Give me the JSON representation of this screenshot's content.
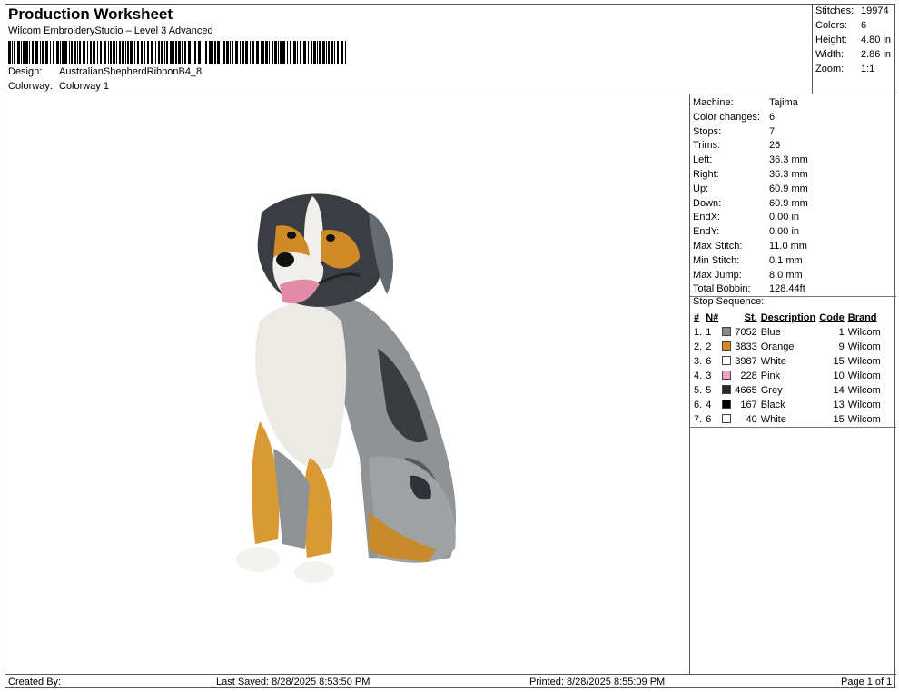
{
  "header": {
    "title": "Production Worksheet",
    "subtitle": "Wilcom EmbroideryStudio – Level 3 Advanced",
    "design_label": "Design:",
    "design_value": "AustralianShepherdRibbonB4_8",
    "colorway_label": "Colorway:",
    "colorway_value": "Colorway 1"
  },
  "stats": [
    {
      "label": "Stitches:",
      "value": "19974"
    },
    {
      "label": "Colors:",
      "value": "6"
    },
    {
      "label": "Height:",
      "value": "4.80 in"
    },
    {
      "label": "Width:",
      "value": "2.86 in"
    },
    {
      "label": "Zoom:",
      "value": "1:1"
    }
  ],
  "machine_info": [
    {
      "label": "Machine:",
      "value": "Tajima"
    },
    {
      "label": "Color changes:",
      "value": "6"
    },
    {
      "label": "Stops:",
      "value": "7"
    },
    {
      "label": "Trims:",
      "value": "26"
    },
    {
      "label": "Left:",
      "value": "36.3 mm"
    },
    {
      "label": "Right:",
      "value": "36.3 mm"
    },
    {
      "label": "Up:",
      "value": "60.9 mm"
    },
    {
      "label": "Down:",
      "value": "60.9 mm"
    },
    {
      "label": "EndX:",
      "value": "0.00 in"
    },
    {
      "label": "EndY:",
      "value": "0.00 in"
    },
    {
      "label": "Max Stitch:",
      "value": "11.0 mm"
    },
    {
      "label": "Min Stitch:",
      "value": "0.1 mm"
    },
    {
      "label": "Max Jump:",
      "value": "8.0 mm"
    },
    {
      "label": "Total Bobbin:",
      "value": "128.44ft"
    }
  ],
  "stop_sequence": {
    "title": "Stop Sequence:",
    "headers": {
      "num": "#",
      "n": "N#",
      "st": "St.",
      "desc": "Description",
      "code": "Code",
      "brand": "Brand"
    },
    "rows": [
      {
        "num": "1.",
        "n": "1",
        "color": "#8a8a8a",
        "st": "7052",
        "desc": "Blue",
        "code": "1",
        "brand": "Wilcom"
      },
      {
        "num": "2.",
        "n": "2",
        "color": "#d48a1e",
        "st": "3833",
        "desc": "Orange",
        "code": "9",
        "brand": "Wilcom"
      },
      {
        "num": "3.",
        "n": "6",
        "color": "#ffffff",
        "st": "3987",
        "desc": "White",
        "code": "15",
        "brand": "Wilcom"
      },
      {
        "num": "4.",
        "n": "3",
        "color": "#f0a0c8",
        "st": "228",
        "desc": "Pink",
        "code": "10",
        "brand": "Wilcom"
      },
      {
        "num": "5.",
        "n": "5",
        "color": "#2a2a2a",
        "st": "4665",
        "desc": "Grey",
        "code": "14",
        "brand": "Wilcom"
      },
      {
        "num": "6.",
        "n": "4",
        "color": "#000000",
        "st": "167",
        "desc": "Black",
        "code": "13",
        "brand": "Wilcom"
      },
      {
        "num": "7.",
        "n": "6",
        "color": "#ffffff",
        "st": "40",
        "desc": "White",
        "code": "15",
        "brand": "Wilcom"
      }
    ]
  },
  "footer": {
    "created_by": "Created By:",
    "last_saved": "Last Saved: 8/28/2025 8:53:50 PM",
    "printed": "Printed: 8/28/2025 8:55:09 PM",
    "page": "Page 1 of 1"
  }
}
